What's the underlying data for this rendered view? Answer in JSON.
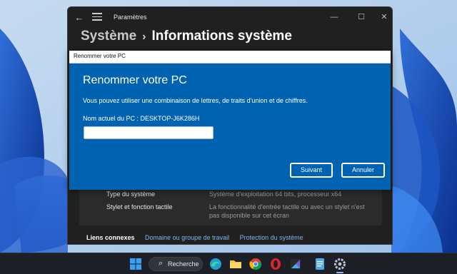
{
  "window": {
    "title": "Paramètres",
    "controls": {
      "minimize": "—",
      "maximize": "☐",
      "close": "✕"
    }
  },
  "breadcrumb": {
    "parent": "Système",
    "separator": "›",
    "current": "Informations système"
  },
  "system_info": {
    "rows": [
      {
        "label": "Type du système",
        "value": "Système d'exploitation 64 bits, processeur x64"
      },
      {
        "label": "Stylet et fonction tactile",
        "value": "La fonctionnalité d'entrée tactile ou avec un stylet n'est pas disponible sur cet écran"
      }
    ]
  },
  "related_links": {
    "title": "Liens connexes",
    "links": [
      "Domaine ou groupe de travail",
      "Protection du système"
    ]
  },
  "dialog": {
    "window_title": "Renommer votre PC",
    "heading": "Renommer votre PC",
    "description": "Vous pouvez utiliser une combinaison de lettres, de traits d'union et de chiffres.",
    "current_name_text": "Nom actuel du PC : DESKTOP-J6K286H",
    "input_value": "",
    "input_placeholder": "",
    "next_label": "Suivant",
    "cancel_label": "Annuler"
  },
  "taskbar": {
    "search_label": "Recherche",
    "icons": [
      "start-icon",
      "search-icon",
      "edge-icon",
      "file-explorer-icon",
      "chrome-icon",
      "opera-icon",
      "app-icon",
      "notepad-icon",
      "settings-icon"
    ]
  },
  "colors": {
    "dialog_blue": "#0063b1",
    "link_blue": "#79b8f0",
    "window_bg": "#202020",
    "taskbar_bg": "#1c1f26"
  }
}
